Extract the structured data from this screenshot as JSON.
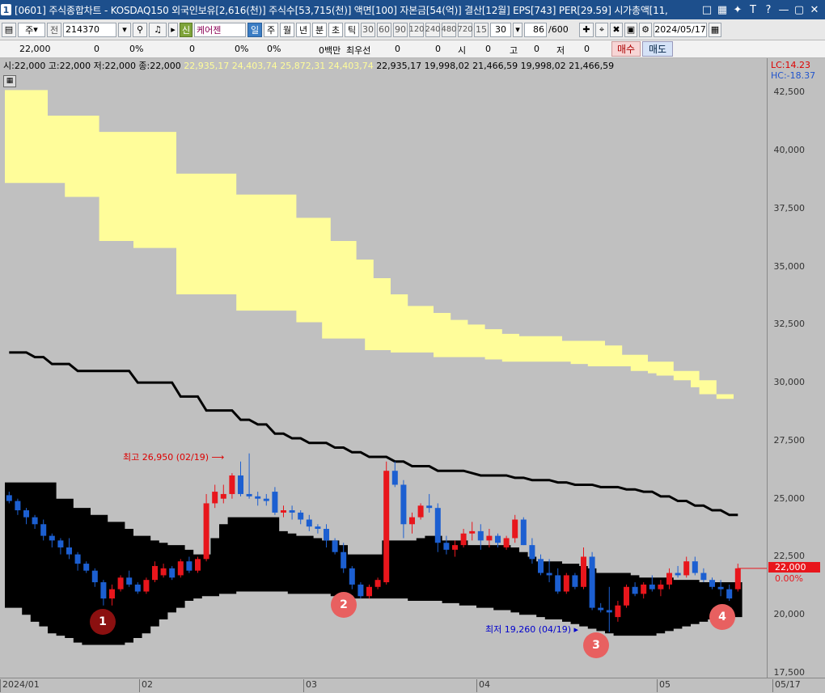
{
  "window": {
    "number": "1",
    "title": "[0601] 주식종합차트 - KOSDAQ150 외국인보유[2,616(천)] 주식수[53,715(천)] 액면[100] 자본금[54(억)] 결산[12월] EPS[743] PER[29.59] 시가총액[11,"
  },
  "toolbar": {
    "market": "주",
    "prefix": "전",
    "code": "214370",
    "new_badge": "신",
    "stock_name": "케어젠",
    "periods": [
      "일",
      "주",
      "월",
      "년",
      "분",
      "초",
      "틱"
    ],
    "active_period": "일",
    "intervals": [
      "30",
      "60",
      "90",
      "120",
      "240",
      "480",
      "720",
      "15"
    ],
    "interval_value": "30",
    "count": "86",
    "count_max": "/600",
    "date": "2024/05/17"
  },
  "quote": {
    "price": "22,000",
    "c1": "0",
    "c2": "0%",
    "c3": "0",
    "c4": "0%",
    "c5": "0%",
    "vol": "0백만",
    "best": "최우선",
    "b1": "0",
    "b2": "0",
    "open_label": "시",
    "open": "0",
    "high_label": "고",
    "high": "0",
    "low_label": "저",
    "low": "0",
    "buy": "매수",
    "sell": "매도"
  },
  "legend": {
    "ohlc": "시:22,000 고:22,000 저:22,000 종:22,000",
    "yellow": "22,935,17 24,403,74 25,872,31 24,403,74",
    "black": "22,935,17 19,998,02 21,466,59 19,998,02 21,466,59"
  },
  "right_labels": {
    "lc": "LC:14.23",
    "hc": "HC:-18.37",
    "price": "22,000",
    "change": "0.00%"
  },
  "annotations": {
    "high": "최고 26,950 (02/19)",
    "low": "최저 19,260 (04/19)",
    "markers": [
      "1",
      "2",
      "3",
      "4"
    ]
  },
  "colors": {
    "up": "#e8161c",
    "down": "#1c5fd1",
    "yellow_cloud": "#fffd9a",
    "black_cloud": "#000000",
    "marker_dark": "#8b1010",
    "marker_light": "#e86060"
  },
  "chart_data": {
    "type": "candlestick",
    "ylim": [
      17500,
      43000
    ],
    "yticks": [
      "42,500",
      "40,000",
      "37,500",
      "35,000",
      "32,500",
      "30,000",
      "27,500",
      "25,000",
      "22,500",
      "20,000",
      "17,500"
    ],
    "xticks": [
      "2024/01",
      "02",
      "03",
      "04",
      "05",
      "05/17"
    ],
    "candles": [
      [
        25150,
        25300,
        24800,
        24900
      ],
      [
        24900,
        25000,
        24300,
        24500
      ],
      [
        24500,
        24600,
        23900,
        24200
      ],
      [
        24200,
        24300,
        23700,
        23900
      ],
      [
        23900,
        24100,
        23200,
        23400
      ],
      [
        23400,
        23500,
        22900,
        23200
      ],
      [
        23200,
        23300,
        22600,
        22900
      ],
      [
        22900,
        23300,
        22400,
        22600
      ],
      [
        22600,
        22700,
        21900,
        22200
      ],
      [
        22200,
        22300,
        21800,
        21900
      ],
      [
        21900,
        22000,
        21200,
        21400
      ],
      [
        21400,
        21500,
        20400,
        20700
      ],
      [
        20700,
        21300,
        20400,
        21100
      ],
      [
        21100,
        21700,
        21000,
        21600
      ],
      [
        21600,
        21900,
        21200,
        21300
      ],
      [
        21300,
        21400,
        20900,
        21000
      ],
      [
        21000,
        21600,
        20900,
        21500
      ],
      [
        21500,
        22300,
        21400,
        22100
      ],
      [
        21700,
        22200,
        21600,
        22000
      ],
      [
        22000,
        22100,
        21500,
        21600
      ],
      [
        21700,
        22400,
        21600,
        22300
      ],
      [
        22300,
        22500,
        21800,
        21900
      ],
      [
        21900,
        22500,
        21800,
        22400
      ],
      [
        22400,
        25200,
        22300,
        24800
      ],
      [
        24800,
        25600,
        24600,
        25300
      ],
      [
        25000,
        25600,
        24800,
        25200
      ],
      [
        25200,
        26100,
        25000,
        26000
      ],
      [
        26000,
        26600,
        25100,
        25200
      ],
      [
        25200,
        26950,
        25000,
        25100
      ],
      [
        25100,
        25300,
        24700,
        25000
      ],
      [
        25000,
        25200,
        24700,
        24900
      ],
      [
        25300,
        25500,
        24300,
        24400
      ],
      [
        24400,
        24700,
        24200,
        24500
      ],
      [
        24500,
        24700,
        24100,
        24400
      ],
      [
        24400,
        24500,
        23900,
        24100
      ],
      [
        24100,
        24300,
        23600,
        23800
      ],
      [
        23800,
        23900,
        23500,
        23700
      ],
      [
        23700,
        23900,
        22900,
        23200
      ],
      [
        23200,
        23300,
        22600,
        22700
      ],
      [
        22700,
        23100,
        21800,
        22000
      ],
      [
        22000,
        22100,
        21100,
        21300
      ],
      [
        21300,
        21400,
        20700,
        20800
      ],
      [
        20800,
        21300,
        20700,
        21200
      ],
      [
        21200,
        21600,
        21100,
        21500
      ],
      [
        21400,
        26600,
        21300,
        26200
      ],
      [
        26200,
        26600,
        25500,
        25600
      ],
      [
        25600,
        25800,
        23300,
        23900
      ],
      [
        23900,
        24400,
        23500,
        24200
      ],
      [
        24200,
        24800,
        24100,
        24700
      ],
      [
        24700,
        25200,
        24400,
        24600
      ],
      [
        24600,
        24800,
        22700,
        23100
      ],
      [
        23100,
        23400,
        22600,
        22800
      ],
      [
        22800,
        23200,
        22500,
        23000
      ],
      [
        23000,
        23700,
        22900,
        23500
      ],
      [
        23500,
        24000,
        23200,
        23600
      ],
      [
        23600,
        23900,
        22800,
        23200
      ],
      [
        23200,
        23700,
        22900,
        23400
      ],
      [
        23400,
        23500,
        22900,
        23100
      ],
      [
        22900,
        23400,
        22800,
        23300
      ],
      [
        23300,
        24300,
        23100,
        24100
      ],
      [
        24100,
        24200,
        23000,
        23000
      ],
      [
        23000,
        23300,
        22200,
        22400
      ],
      [
        22400,
        22600,
        21700,
        21800
      ],
      [
        21800,
        22400,
        21400,
        21700
      ],
      [
        21700,
        22000,
        20900,
        21000
      ],
      [
        21000,
        21800,
        20900,
        21700
      ],
      [
        21700,
        21800,
        21100,
        21200
      ],
      [
        21200,
        22900,
        21100,
        22500
      ],
      [
        22500,
        22700,
        20200,
        20300
      ],
      [
        20300,
        20500,
        20100,
        20200
      ],
      [
        20200,
        21200,
        19260,
        20100
      ],
      [
        19900,
        20600,
        19700,
        20400
      ],
      [
        20400,
        21300,
        20300,
        21200
      ],
      [
        21200,
        21400,
        20800,
        20900
      ],
      [
        20900,
        21400,
        20700,
        21300
      ],
      [
        21300,
        21700,
        21000,
        21100
      ],
      [
        21100,
        21500,
        20800,
        21300
      ],
      [
        21300,
        22000,
        21100,
        21800
      ],
      [
        21800,
        22100,
        21600,
        21700
      ],
      [
        21700,
        22500,
        21600,
        22300
      ],
      [
        22300,
        22500,
        21700,
        21800
      ],
      [
        21800,
        22000,
        21400,
        21500
      ],
      [
        21500,
        21600,
        21100,
        21200
      ],
      [
        21200,
        21500,
        20800,
        21100
      ],
      [
        21100,
        21300,
        20600,
        20700
      ],
      [
        21100,
        22200,
        21000,
        22000
      ]
    ],
    "conversion_line": [
      31400,
      31400,
      31400,
      31400,
      31400,
      31400,
      31400,
      31100,
      30800,
      30800,
      30800,
      30800,
      30800,
      30800,
      30800,
      30800,
      29800,
      29800,
      29800,
      29800,
      29800,
      29800,
      29800,
      29800,
      29200,
      29200,
      29200,
      29200,
      29200,
      29200,
      29200,
      29200,
      29200,
      29200,
      29200,
      29200,
      28400,
      28400,
      28400,
      28400,
      28400,
      28400,
      28400,
      28400,
      28400,
      28400,
      28400,
      28400,
      28400,
      28400,
      28400,
      28400,
      28400,
      28400,
      28400,
      28400,
      28400,
      28400,
      28400,
      28400,
      28400,
      28400,
      28400,
      28400,
      28400,
      28400,
      28400,
      28400,
      28400,
      28400,
      28400,
      28400,
      28400,
      28400,
      28400,
      28400,
      28400,
      28400,
      28400,
      28400,
      28400,
      28400,
      28400,
      28400,
      28400,
      28400
    ],
    "span_a": [
      42600,
      42600,
      42600,
      42600,
      42600,
      41500,
      41500,
      41500,
      41500,
      41500,
      41500,
      40800,
      40800,
      40800,
      40800,
      40800,
      40800,
      40800,
      40800,
      40800,
      39000,
      39000,
      39000,
      39000,
      39000,
      39000,
      39000,
      38100,
      38100,
      38100,
      38100,
      38100,
      38100,
      38100,
      37100,
      37100,
      37100,
      37100,
      36100,
      36100,
      36100,
      35300,
      35300,
      34500,
      34500,
      33800,
      33800,
      33300,
      33300,
      33300,
      33000,
      33000,
      32700,
      32700,
      32500,
      32500,
      32300,
      32300,
      32100,
      32100,
      32000,
      32000,
      32000,
      32000,
      32000,
      31800,
      31800,
      31800,
      31800,
      31800,
      31600,
      31600,
      31200,
      31200,
      31200,
      30900,
      30900,
      30900,
      30500,
      30500,
      30500,
      30100,
      30100,
      29500,
      29500,
      28900
    ],
    "span_b": [
      38600,
      38600,
      38600,
      38600,
      38600,
      38600,
      38600,
      38000,
      38000,
      38000,
      38000,
      36100,
      36100,
      36100,
      36100,
      35800,
      35800,
      35800,
      35800,
      35800,
      33800,
      33800,
      33800,
      33800,
      33800,
      33800,
      33800,
      33100,
      33100,
      33100,
      33100,
      33100,
      33100,
      33100,
      32600,
      32600,
      32600,
      31900,
      31900,
      31900,
      31900,
      31900,
      31400,
      31400,
      31400,
      31300,
      31300,
      31300,
      31300,
      31300,
      31100,
      31100,
      31100,
      31100,
      31100,
      31100,
      31000,
      31000,
      30900,
      30900,
      30900,
      30900,
      30900,
      30900,
      30900,
      30900,
      30800,
      30800,
      30700,
      30700,
      30700,
      30700,
      30700,
      30500,
      30500,
      30400,
      30300,
      30300,
      30100,
      30100,
      29800,
      29500,
      29500,
      29300,
      29300,
      28900
    ],
    "kijun": [
      31300,
      31300,
      31300,
      31100,
      31100,
      30800,
      30800,
      30800,
      30500,
      30500,
      30500,
      30500,
      30500,
      30500,
      30500,
      30000,
      30000,
      30000,
      30000,
      30000,
      29400,
      29400,
      29400,
      28800,
      28800,
      28800,
      28800,
      28400,
      28400,
      28200,
      28200,
      27800,
      27800,
      27600,
      27600,
      27400,
      27400,
      27400,
      27200,
      27200,
      27000,
      27000,
      26800,
      26800,
      26800,
      26600,
      26600,
      26400,
      26400,
      26400,
      26200,
      26200,
      26200,
      26200,
      26100,
      26000,
      26000,
      26000,
      26000,
      25900,
      25900,
      25800,
      25800,
      25800,
      25700,
      25700,
      25600,
      25600,
      25600,
      25500,
      25500,
      25500,
      25400,
      25400,
      25300,
      25300,
      25100,
      25100,
      24900,
      24900,
      24700,
      24700,
      24500,
      24500,
      24300,
      24300
    ],
    "black_top": [
      25700,
      25700,
      25700,
      25700,
      25700,
      25700,
      25000,
      25000,
      24600,
      24600,
      24300,
      24300,
      24000,
      24000,
      23700,
      23400,
      23400,
      23200,
      23100,
      23000,
      23000,
      22800,
      22600,
      22600,
      23300,
      23900,
      24200,
      24200,
      24200,
      24200,
      24200,
      24200,
      23600,
      23500,
      23400,
      23400,
      23300,
      23200,
      23200,
      23000,
      22600,
      22600,
      22600,
      22600,
      23200,
      23200,
      23200,
      23200,
      23300,
      23400,
      23400,
      23200,
      23200,
      23200,
      23000,
      23000,
      23000,
      23000,
      23000,
      22900,
      22700,
      22500,
      22300,
      22300,
      22300,
      22200,
      22200,
      22100,
      22000,
      21800,
      21800,
      21800,
      21800,
      21700,
      21600,
      21600,
      21600,
      21600,
      21500,
      21500,
      21500,
      21400,
      21400,
      21400,
      21400,
      21400
    ],
    "black_bottom": [
      20300,
      20300,
      20000,
      19700,
      19500,
      19200,
      19100,
      19000,
      18800,
      18700,
      18700,
      18700,
      18700,
      18700,
      18800,
      19000,
      19200,
      19500,
      19800,
      20100,
      20300,
      20600,
      20700,
      20800,
      20800,
      20900,
      20900,
      21000,
      21000,
      21000,
      21000,
      21000,
      21000,
      20900,
      20900,
      20900,
      20900,
      20900,
      20800,
      20800,
      20700,
      20700,
      20700,
      20700,
      20700,
      20700,
      20700,
      20600,
      20600,
      20600,
      20600,
      20500,
      20500,
      20400,
      20400,
      20300,
      20300,
      20200,
      20200,
      20100,
      20000,
      20000,
      19900,
      19800,
      19800,
      19700,
      19600,
      19500,
      19400,
      19300,
      19200,
      19100,
      19100,
      19100,
      19100,
      19100,
      19200,
      19300,
      19400,
      19500,
      19600,
      19700,
      19800,
      19800,
      19900,
      19900
    ]
  }
}
